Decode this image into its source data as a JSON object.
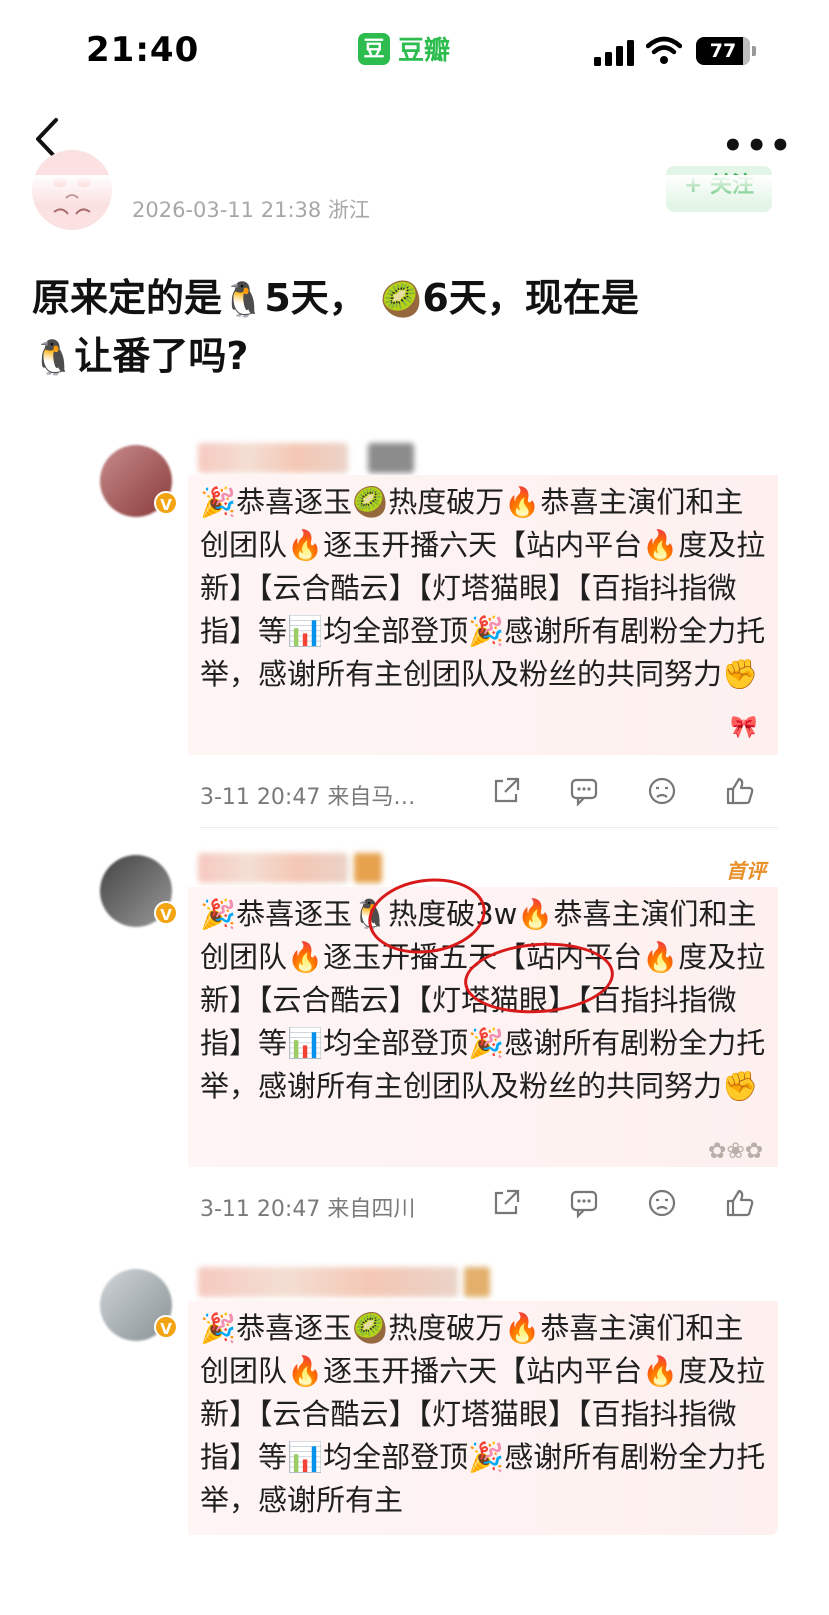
{
  "status_bar": {
    "time": "21:40",
    "app_logo_char": "豆",
    "app_name": "豆瓣",
    "battery": "77"
  },
  "nav": {
    "back_icon": "back-arrow-icon",
    "more_icon": "more-icon",
    "more_glyph": "•••"
  },
  "post": {
    "meta": "2026-03-11 21:38  浙江",
    "follow_label": "+ 关注",
    "text_parts": [
      "原来定的是",
      "🐧",
      "5天，",
      "🥝",
      "6天，现在是",
      "🐧",
      "让番了吗?"
    ]
  },
  "comments": [
    {
      "body_parts": [
        "🎉",
        "恭喜逐玉",
        "🥝",
        "热度破万",
        "🔥",
        "恭喜主演们和主创团队",
        "🔥",
        "逐玉开播六天【站内平台",
        "🔥",
        "度及拉新】【云合酷云】【灯塔猫眼】【百指抖指微指】等",
        "📊",
        "均全部登顶",
        "🎉",
        "感谢所有剧粉全力托举，感谢所有主创团队及粉丝的共同努力",
        "✊"
      ],
      "footer_time": "3-11 20:47  来自马…"
    },
    {
      "first_badge": "首评",
      "body_parts": [
        "🎉",
        "恭喜逐玉",
        "🐧",
        "热度破3w",
        "🔥",
        "恭喜主演们和主创团队",
        "🔥",
        "逐玉",
        "开播五天",
        "【站内平台",
        "🔥",
        "度及拉新】【云合酷云】【灯塔猫眼】【百指抖指微指】等",
        "📊",
        "均全部登顶",
        "🎉",
        "感谢所有剧粉全力托举，感谢所有主创团队及粉丝的共同努力",
        "✊"
      ],
      "footer_time": "3-11 20:47  来自四川"
    },
    {
      "body_parts": [
        "🎉",
        "恭喜逐玉",
        "🥝",
        "热度破万",
        "🔥",
        "恭喜主演们和主创团队",
        "🔥",
        "逐玉开播六天【站内平台",
        "🔥",
        "度及拉新】【云合酷云】【灯塔猫眼】【百指抖指微指】等",
        "📊",
        "均全部登顶",
        "🎉",
        "感谢所有剧粉全力托举，感谢所有主"
      ]
    }
  ],
  "colors": {
    "brand_green": "#2dbd4f",
    "annotation_red": "#d81a1a",
    "verified_orange": "#f2a412"
  }
}
